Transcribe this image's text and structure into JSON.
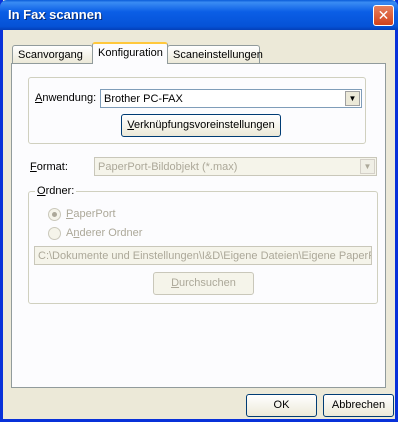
{
  "window": {
    "title": "In Fax scannen",
    "close_symbol": "✕"
  },
  "tabs": [
    {
      "label": "Scanvorgang"
    },
    {
      "label": "Konfiguration"
    },
    {
      "label": "Scaneinstellungen"
    }
  ],
  "anwendung": {
    "label_first": "A",
    "label_rest": "nwendung:",
    "value": "Brother PC-FAX",
    "button_first": "V",
    "button_rest": "erknüpfungsvoreinstellungen"
  },
  "format": {
    "label_first": "F",
    "label_rest": "ormat:",
    "value": "PaperPort-Bildobjekt (*.max)"
  },
  "ordner": {
    "label_first": "O",
    "label_rest": "rdner:",
    "options": [
      {
        "first": "P",
        "rest": "aperPort",
        "checked": true
      },
      {
        "pre": "A",
        "first": "n",
        "rest": "derer Ordner",
        "checked": false
      }
    ],
    "path": "C:\\Dokumente und Einstellungen\\I&D\\Eigene Dateien\\Eigene PaperPor",
    "browse_first": "D",
    "browse_rest": "urchsuchen"
  },
  "buttons": {
    "ok": "OK",
    "cancel": "Abbrechen"
  }
}
